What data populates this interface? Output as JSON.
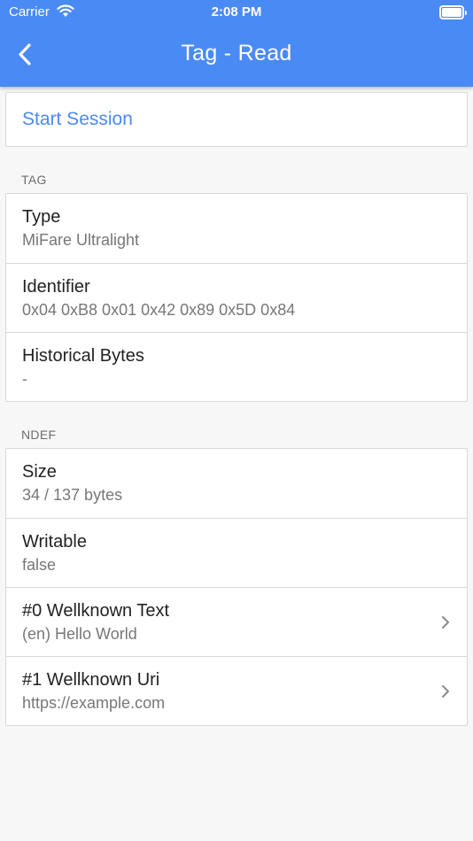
{
  "status_bar": {
    "carrier": "Carrier",
    "time": "2:08 PM",
    "battery_level": 1.0
  },
  "app_bar": {
    "title": "Tag - Read",
    "back_icon": "chevron-left-icon"
  },
  "start_session": {
    "label": "Start Session"
  },
  "sections": {
    "tag": {
      "header": "TAG",
      "rows": [
        {
          "title": "Type",
          "subtitle": "MiFare Ultralight"
        },
        {
          "title": "Identifier",
          "subtitle": "0x04 0xB8 0x01 0x42 0x89 0x5D 0x84"
        },
        {
          "title": "Historical Bytes",
          "subtitle": "-"
        }
      ]
    },
    "ndef": {
      "header": "NDEF",
      "rows": [
        {
          "title": "Size",
          "subtitle": "34 / 137 bytes"
        },
        {
          "title": "Writable",
          "subtitle": "false"
        },
        {
          "title": "#0 Wellknown Text",
          "subtitle": "(en) Hello World",
          "icon": "chevron-right-icon"
        },
        {
          "title": "#1 Wellknown Uri",
          "subtitle": "https://example.com",
          "icon": "chevron-right-icon"
        }
      ]
    }
  },
  "colors": {
    "accent": "#4a8af4",
    "background": "#f7f7f7",
    "card": "#ffffff"
  }
}
